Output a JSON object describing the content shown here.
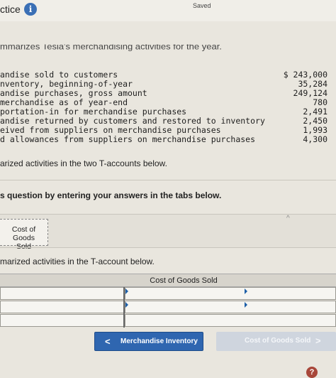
{
  "header": {
    "title": "ctice",
    "info_icon": "i",
    "saved": "Saved"
  },
  "intro_text_cut": "mmarizes Tesia's merchandising activities for the year.",
  "activities": [
    {
      "label": "andise sold to customers",
      "amount": "$ 243,000"
    },
    {
      "label": "nventory, beginning-of-year",
      "amount": "35,284"
    },
    {
      "label": "andise purchases, gross amount",
      "amount": "249,124"
    },
    {
      "label": "merchandise as of year-end",
      "amount": "780"
    },
    {
      "label": "portation-in for merchandise purchases",
      "amount": "2,491"
    },
    {
      "label": "andise returned by customers and restored to inventory",
      "amount": "2,450"
    },
    {
      "label": "eived from suppliers on merchandise purchases",
      "amount": "1,993"
    },
    {
      "label": "d allowances from suppliers on merchandise purchases",
      "amount": "4,300"
    }
  ],
  "instruction_1": "arized activities in the two T-accounts below.",
  "question_text": "s question by entering your answers in the tabs below.",
  "tabs": [
    {
      "line1": "Cost of Goods",
      "line2": "Sold"
    }
  ],
  "instruction_2": "marized activities in the T-account below.",
  "t_account": {
    "title": "Cost of Goods Sold"
  },
  "nav": {
    "prev_label": "Merchandise Inventory",
    "prev_chevron": "<",
    "next_label": "Cost of Goods Sold",
    "next_chevron": ">"
  },
  "help_icon": "?",
  "colors": {
    "primary_button": "#2f66b0",
    "disabled_button": "#cfd5de",
    "info_icon": "#3a6fb5"
  }
}
